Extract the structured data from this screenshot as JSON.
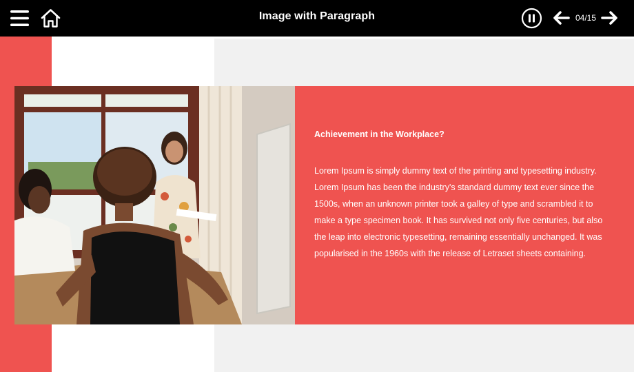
{
  "header": {
    "title": "Image with Paragraph",
    "counter": "04/15",
    "icons": {
      "menu": "hamburger-menu-icon",
      "home": "home-icon",
      "pause": "pause-icon",
      "prev": "arrow-left-icon",
      "next": "arrow-right-icon"
    }
  },
  "content": {
    "heading": "Achievement in the Workplace?",
    "paragraph": "Lorem Ipsum is simply dummy text of the printing and typesetting industry. Lorem Ipsum has been the industry's standard dummy text ever since the 1500s, when an unknown printer took a galley of type and scrambled it to make a type specimen book. It has survived not only five centuries, but also the leap into electronic typesetting, remaining essentially unchanged. It was popularised in the 1960s with the release of Letraset sheets containing."
  },
  "colors": {
    "topbar": "#000000",
    "accent": "#ef5350",
    "panel_gray": "#f1f1f1",
    "text_light": "#ffffff"
  }
}
